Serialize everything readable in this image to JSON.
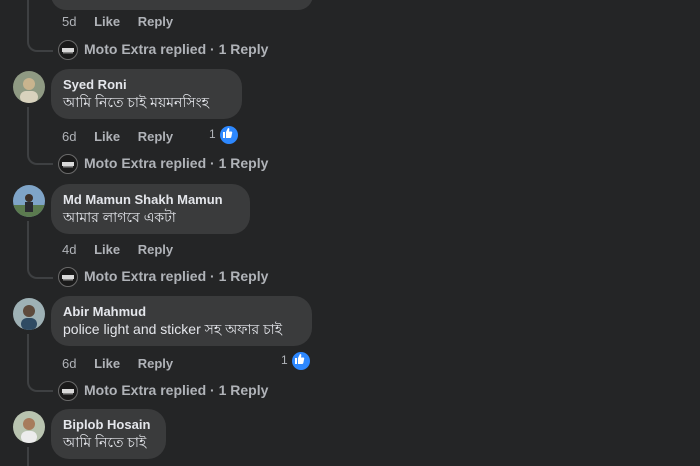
{
  "comments": [
    {
      "author": "",
      "text": "",
      "age": "5d",
      "like_label": "Like",
      "reply_label": "Reply",
      "reaction_count": "",
      "reply_summary": "Moto Extra replied · 1 Reply"
    },
    {
      "author": "Syed Roni",
      "text": "আমি নিতে চাই ময়মনসিংহ",
      "age": "6d",
      "like_label": "Like",
      "reply_label": "Reply",
      "reaction_count": "1",
      "reply_summary": "Moto Extra replied · 1 Reply"
    },
    {
      "author": "Md Mamun Shakh Mamun",
      "text": "আমার লাগবে একটা",
      "age": "4d",
      "like_label": "Like",
      "reply_label": "Reply",
      "reaction_count": "",
      "reply_summary": "Moto Extra replied · 1 Reply"
    },
    {
      "author": "Abir Mahmud",
      "text": "police light and sticker সহ অফার চাই",
      "age": "6d",
      "like_label": "Like",
      "reply_label": "Reply",
      "reaction_count": "1",
      "reply_summary": "Moto Extra replied · 1 Reply"
    },
    {
      "author": "Biplob Hosain",
      "text": "আমি নিতে চাই",
      "age": "",
      "like_label": "",
      "reply_label": "",
      "reaction_count": "",
      "reply_summary": ""
    }
  ],
  "icons": {
    "reaction": "thumbs-up-icon",
    "page_logo": "moto-extra-logo-icon"
  },
  "colors": {
    "background": "#242526",
    "bubble": "#3a3b3c",
    "like_badge": "#2d88ff",
    "secondary_text": "#b0b3b8"
  }
}
